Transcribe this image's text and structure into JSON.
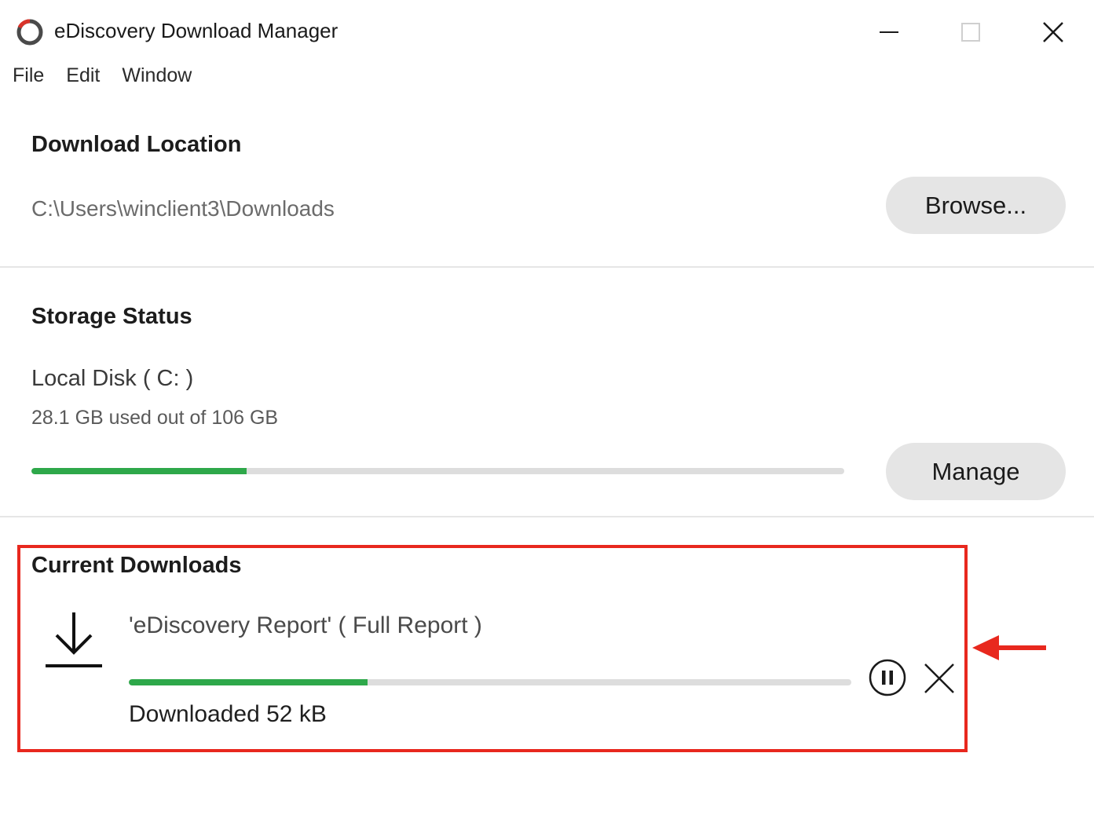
{
  "window": {
    "title": "eDiscovery Download Manager",
    "icon": "ring-logo-icon",
    "controls": [
      "minimize-icon",
      "maximize-icon",
      "close-icon"
    ]
  },
  "menu": {
    "file": "File",
    "edit": "Edit",
    "window": "Window"
  },
  "download_location": {
    "heading": "Download Location",
    "path": "C:\\Users\\winclient3\\Downloads",
    "browse_label": "Browse..."
  },
  "storage_status": {
    "heading": "Storage Status",
    "disk_name": "Local Disk ( C: )",
    "usage_text": "28.1 GB used out of 106 GB",
    "used_fraction": 0.265,
    "manage_label": "Manage"
  },
  "current_downloads": {
    "heading": "Current Downloads",
    "items": [
      {
        "name": "'eDiscovery Report' ( Full Report )",
        "status": "Downloaded 52 kB",
        "progress_fraction": 0.33,
        "icon": "download-arrow-icon"
      }
    ]
  },
  "colors": {
    "progress": "#2ea84a",
    "track": "#dddddd",
    "highlight": "#e8281e",
    "button_bg": "#e5e5e5"
  }
}
